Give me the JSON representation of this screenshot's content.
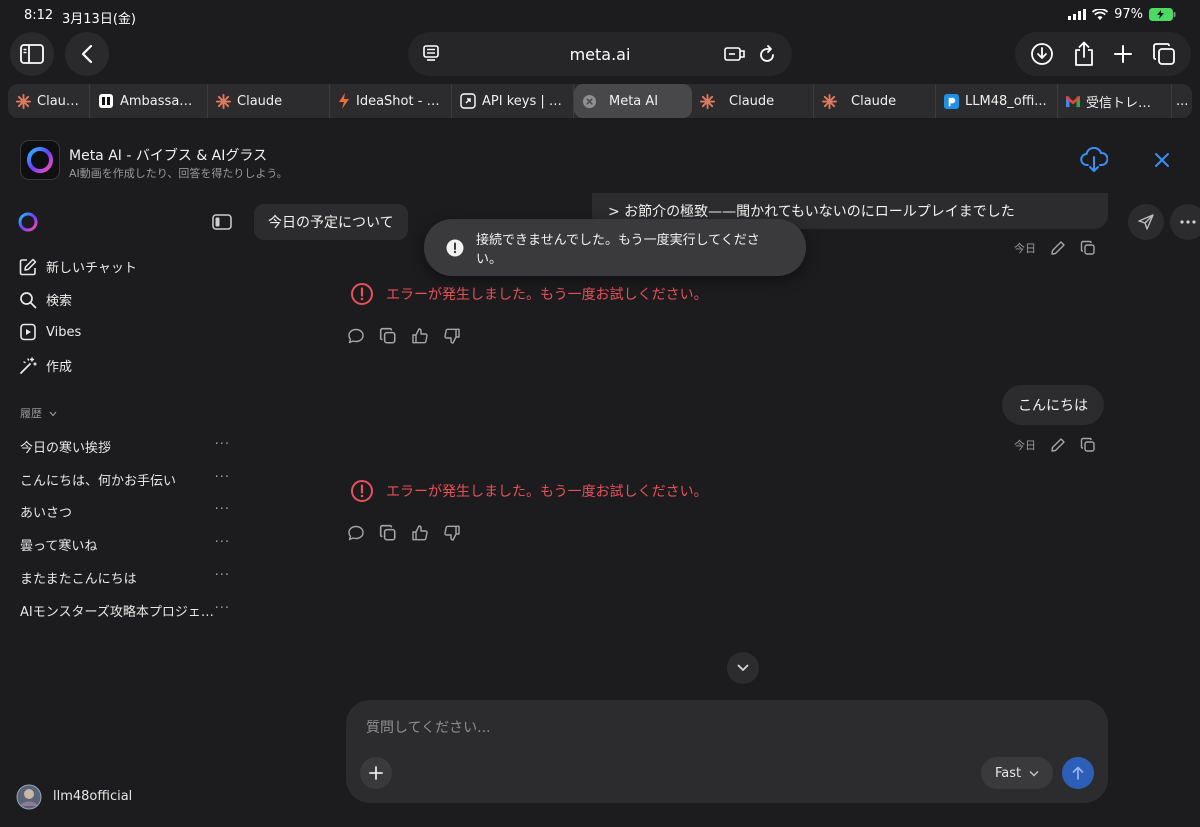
{
  "status_bar": {
    "time": "8:12",
    "date": "3月13日(金)",
    "battery": "97%"
  },
  "browser": {
    "url": "meta.ai",
    "tabs": [
      {
        "label": "Claude",
        "icon": "claude-icon",
        "active": false
      },
      {
        "label": "Ambassado...",
        "icon": "ambassador-icon",
        "active": false
      },
      {
        "label": "Claude",
        "icon": "claude-icon",
        "active": false
      },
      {
        "label": "IdeaShot - F...",
        "icon": "ideashot-icon",
        "active": false
      },
      {
        "label": "API keys | G...",
        "icon": "api-keys-icon",
        "active": false
      },
      {
        "label": "Meta AI",
        "icon": "close-icon",
        "active": true
      },
      {
        "label": "Claude",
        "icon": "claude-icon",
        "active": false
      },
      {
        "label": "Claude",
        "icon": "claude-icon",
        "active": false
      },
      {
        "label": "LLM48_offi...",
        "icon": "llm48-icon",
        "active": false
      },
      {
        "label": "受信トレイ (...",
        "icon": "gmail-icon",
        "active": false
      }
    ],
    "more_tabs": "..."
  },
  "app_banner": {
    "title": "Meta AI - バイブス & AIグラス",
    "subtitle": "AI動画を作成したり、回答を得たりしよう。"
  },
  "sidebar": {
    "nav": [
      {
        "label": "新しいチャット",
        "icon": "new-chat-icon"
      },
      {
        "label": "検索",
        "icon": "search-icon"
      },
      {
        "label": "Vibes",
        "icon": "vibes-icon"
      },
      {
        "label": "作成",
        "icon": "create-icon"
      }
    ],
    "history_label": "履歴",
    "history": [
      "今日の寒い挨拶",
      "こんにちは、何かお手伝い",
      "あいさつ",
      "曇って寒いね",
      "またまたこんにちは",
      "AIモンスターズ攻略本プロジェクト"
    ],
    "item_more": "···",
    "user": "llm48official"
  },
  "chat": {
    "chat_title": "今日の予定について",
    "messages": {
      "quoted_user_message": "> お節介の極致——聞かれてもいないのにロールプレイまでした",
      "second_user_message": "こんにちは"
    },
    "time_label": "今日",
    "error_text": "エラーが発生しました。もう一度お試しください。",
    "toast": "接続できませんでした。もう一度実行してください。"
  },
  "composer": {
    "placeholder": "質問してください...",
    "mode": "Fast"
  },
  "colors": {
    "background": "#1c1c1e",
    "error": "#e8505a",
    "send_button": "#2d5fb8",
    "accent_blue": "#3b8ef5"
  }
}
